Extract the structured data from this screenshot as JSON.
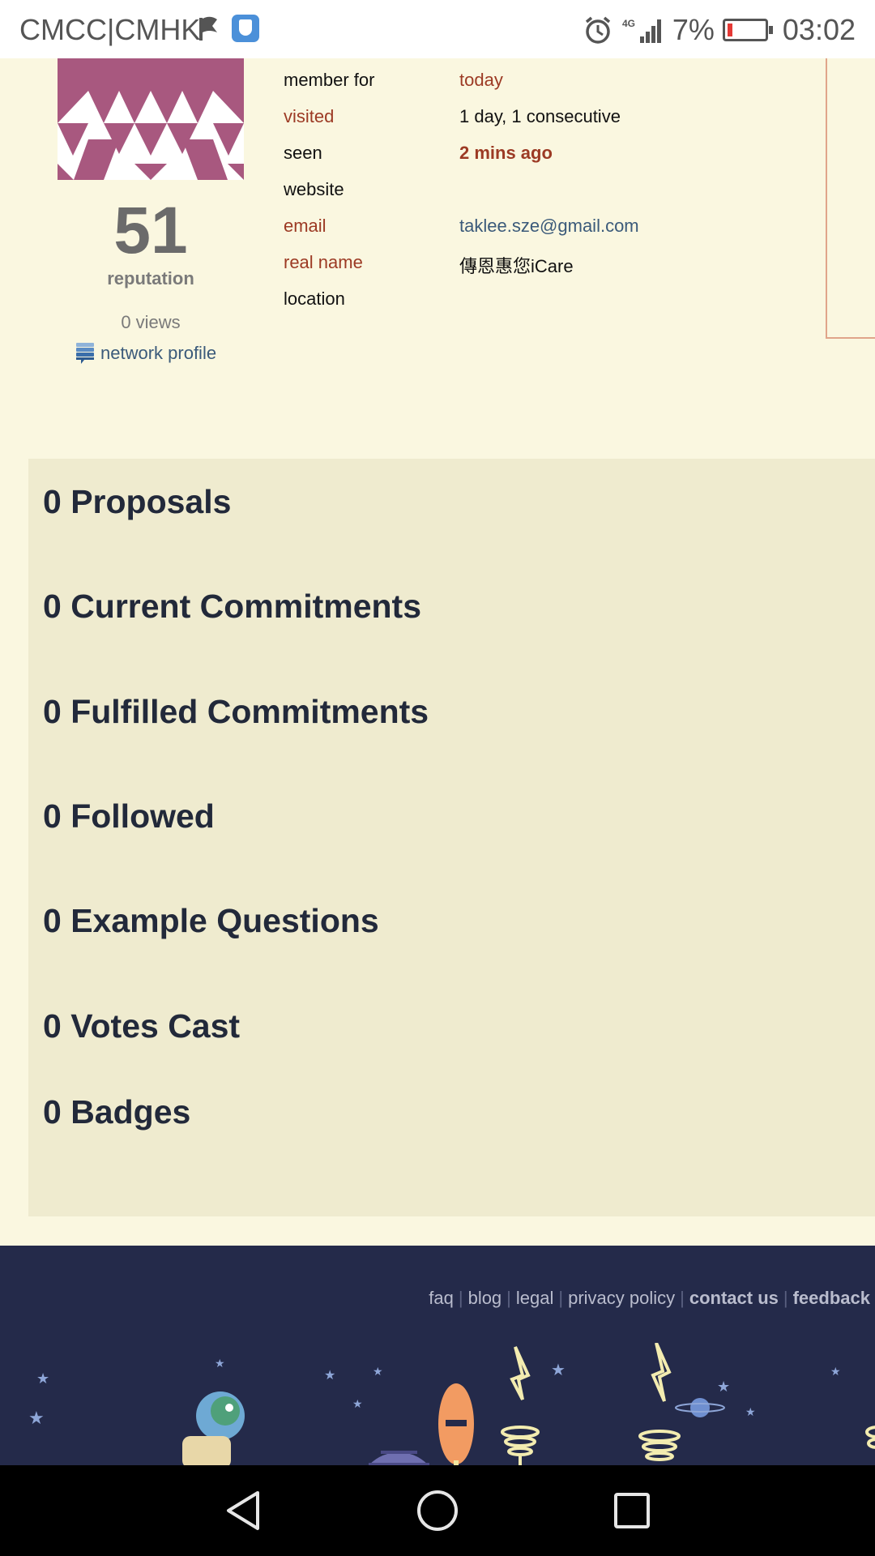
{
  "status_bar": {
    "carrier": "CMCC|CMHK",
    "network_type": "4G",
    "battery_percent": "7%",
    "time": "03:02",
    "icons": [
      "flag-icon",
      "shield-icon",
      "alarm-icon",
      "signal-icon",
      "battery-icon"
    ]
  },
  "profile": {
    "reputation_value": "51",
    "reputation_label": "reputation",
    "views": "0 views",
    "network_profile": "network profile",
    "avatar_colors": {
      "primary": "#a8587f",
      "background": "#ffffff"
    }
  },
  "info": [
    {
      "key": "member for",
      "value": "today"
    },
    {
      "key": "visited",
      "value": "1 day, 1 consecutive"
    },
    {
      "key": "seen",
      "value": "2 mins ago"
    },
    {
      "key": "website",
      "value": ""
    },
    {
      "key": "email",
      "value": "taklee.sze@gmail.com"
    },
    {
      "key": "real name",
      "value": "傳恩惠您iCare"
    },
    {
      "key": "location",
      "value": ""
    }
  ],
  "stats": [
    "0 Proposals",
    "0 Current Commitments",
    "0 Fulfilled Commitments",
    "0 Followed",
    "0 Example Questions",
    "0 Votes Cast",
    "0 Badges"
  ],
  "footer": {
    "links": [
      "faq",
      "blog",
      "legal",
      "privacy policy",
      "contact us",
      "feedback"
    ]
  },
  "nav": {
    "icons": [
      "back-icon",
      "home-icon",
      "recents-icon"
    ]
  },
  "colors": {
    "page_bg": "#faf7e0",
    "panel_bg": "#efebcf",
    "accent_red": "#9c3a24",
    "link_blue": "#3b5a7a",
    "footer_bg": "#242a4a"
  }
}
